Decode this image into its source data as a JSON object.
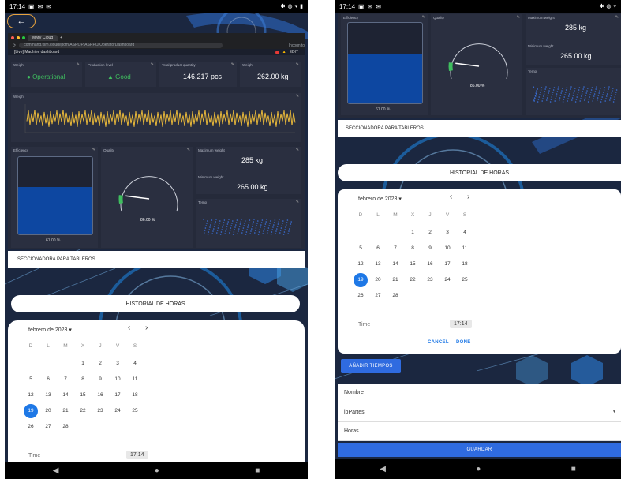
{
  "status_bar": {
    "time": "17:14",
    "icons": [
      "image-icon",
      "mail-icon",
      "mail-icon"
    ],
    "right_icons": [
      "bluetooth-icon",
      "vibrate-icon",
      "wifi-icon",
      "battery-icon"
    ]
  },
  "left": {
    "back_button": "←",
    "browser": {
      "tab_title": "MMV Cloud",
      "new_tab": "+",
      "url": "command.tsm.cloud/ipcm/ASROP/ASRPO/OperatorDashboard",
      "incognito": "Incognito"
    },
    "dashboard": {
      "title": "[Live] Machine dashboard",
      "edit_label": "EDIT",
      "tiles": {
        "weight1": {
          "title": "Weight",
          "status": "Operational"
        },
        "production": {
          "title": "Production level",
          "status": "Good"
        },
        "total": {
          "title": "Total product quantity",
          "value": "146,217 pcs"
        },
        "weight2": {
          "title": "Weight",
          "value": "262.00 kg"
        },
        "chart": {
          "title": "Weight"
        },
        "efficiency": {
          "title": "Efficiency",
          "value": "61.00 %"
        },
        "quality": {
          "title": "Quality",
          "value": "86.00 %"
        },
        "max_weight": {
          "title": "Maximum weight",
          "value": "285 kg"
        },
        "min_weight": {
          "title": "Minimum weight",
          "value": "265.00 kg"
        },
        "temp": {
          "title": "Temp"
        }
      }
    },
    "section_card": "SECCIONADORA PARA TABLEROS",
    "history_button": "HISTORIAL DE HORAS",
    "calendar": {
      "month": "febrero de 2023",
      "weekdays": [
        "D",
        "L",
        "M",
        "X",
        "J",
        "V",
        "S"
      ],
      "days": [
        [
          "",
          "",
          "",
          "1",
          "2",
          "3",
          "4"
        ],
        [
          "5",
          "6",
          "7",
          "8",
          "9",
          "10",
          "11"
        ],
        [
          "12",
          "13",
          "14",
          "15",
          "16",
          "17",
          "18"
        ],
        [
          "19",
          "20",
          "21",
          "22",
          "23",
          "24",
          "25"
        ],
        [
          "26",
          "27",
          "28",
          "",
          "",
          "",
          ""
        ]
      ],
      "selected": "19",
      "time_label": "Time",
      "time_value": "17:14"
    }
  },
  "right": {
    "tiles": {
      "efficiency": {
        "title": "Efficiency",
        "value": "61.00 %"
      },
      "quality": {
        "title": "Quality",
        "value": "86.00 %"
      },
      "max_weight": {
        "title": "Maximum weight",
        "value": "285 kg"
      },
      "min_weight": {
        "title": "Minimum weight",
        "value": "265.00 kg"
      },
      "temp": {
        "title": "Temp"
      }
    },
    "section_card": "SECCIONADORA PARA TABLEROS",
    "history_button": "HISTORIAL DE HORAS",
    "calendar": {
      "month": "febrero de 2023",
      "weekdays": [
        "D",
        "L",
        "M",
        "X",
        "J",
        "V",
        "S"
      ],
      "days": [
        [
          "",
          "",
          "",
          "1",
          "2",
          "3",
          "4"
        ],
        [
          "5",
          "6",
          "7",
          "8",
          "9",
          "10",
          "11"
        ],
        [
          "12",
          "13",
          "14",
          "15",
          "16",
          "17",
          "18"
        ],
        [
          "19",
          "20",
          "21",
          "22",
          "23",
          "24",
          "25"
        ],
        [
          "26",
          "27",
          "28",
          "",
          "",
          "",
          ""
        ]
      ],
      "selected": "19",
      "time_label": "Time",
      "time_value": "17:14",
      "cancel": "CANCEL",
      "done": "DONE"
    },
    "add_times_button": "AÑADIR TIEMPOS",
    "fields": {
      "name": "Nombre",
      "parts": "ipPartes",
      "hours": "Horas"
    },
    "save_button": "GUARDAR"
  },
  "nav": {
    "back": "◀",
    "home": "●",
    "recents": "■"
  },
  "colors": {
    "accent": "#1e78e6",
    "save": "#2f6be0",
    "tank": "#0d47a1",
    "gauge": "#3fbf5f",
    "chart_line": "#e8b83a",
    "temp_dots": "#3a6fd8"
  },
  "gauge_fraction": 0.86,
  "efficiency_fraction": 0.61
}
